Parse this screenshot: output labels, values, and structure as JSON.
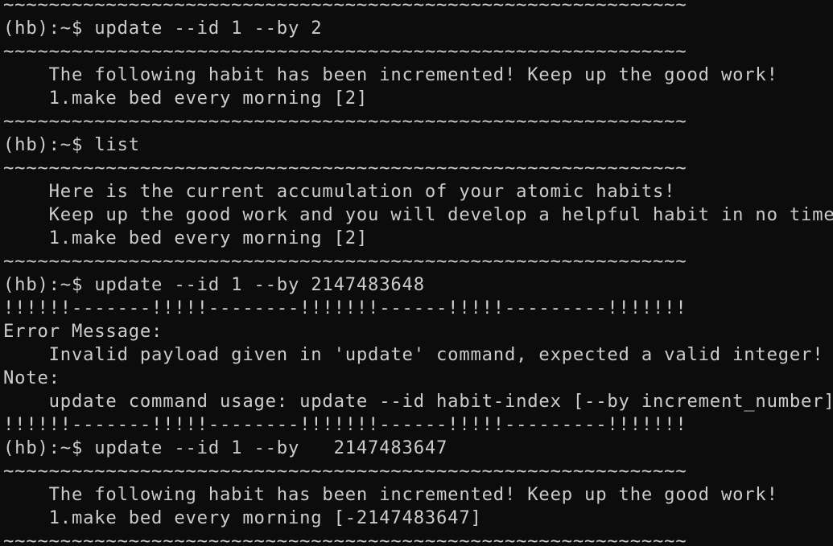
{
  "terminal": {
    "colors": {
      "background": "#0c0c0c",
      "foreground": "#cccccc"
    },
    "lines": [
      "~~~~~~~~~~~~~~~~~~~~~~~~~~~~~~~~~~~~~~~~~~~~~~~~~~~~~~~~~~~~",
      "(hb):~$ update --id 1 --by 2",
      "~~~~~~~~~~~~~~~~~~~~~~~~~~~~~~~~~~~~~~~~~~~~~~~~~~~~~~~~~~~~",
      "    The following habit has been incremented! Keep up the good work!",
      "    1.make bed every morning [2]",
      "~~~~~~~~~~~~~~~~~~~~~~~~~~~~~~~~~~~~~~~~~~~~~~~~~~~~~~~~~~~~",
      "(hb):~$ list",
      "~~~~~~~~~~~~~~~~~~~~~~~~~~~~~~~~~~~~~~~~~~~~~~~~~~~~~~~~~~~~",
      "    Here is the current accumulation of your atomic habits!",
      "    Keep up the good work and you will develop a helpful habit in no time",
      "    1.make bed every morning [2]",
      "~~~~~~~~~~~~~~~~~~~~~~~~~~~~~~~~~~~~~~~~~~~~~~~~~~~~~~~~~~~~",
      "(hb):~$ update --id 1 --by 2147483648",
      "!!!!!!-------!!!!!--------!!!!!!!------!!!!!---------!!!!!!!",
      "Error Message:",
      "    Invalid payload given in 'update' command, expected a valid integer!",
      "Note:",
      "    update command usage: update --id habit-index [--by increment_number]",
      "!!!!!!-------!!!!!--------!!!!!!!------!!!!!---------!!!!!!!",
      "(hb):~$ update --id 1 --by   2147483647",
      "~~~~~~~~~~~~~~~~~~~~~~~~~~~~~~~~~~~~~~~~~~~~~~~~~~~~~~~~~~~~",
      "    The following habit has been incremented! Keep up the good work!",
      "    1.make bed every morning [-2147483647]",
      "~~~~~~~~~~~~~~~~~~~~~~~~~~~~~~~~~~~~~~~~~~~~~~~~~~~~~~~~~~~~"
    ]
  }
}
